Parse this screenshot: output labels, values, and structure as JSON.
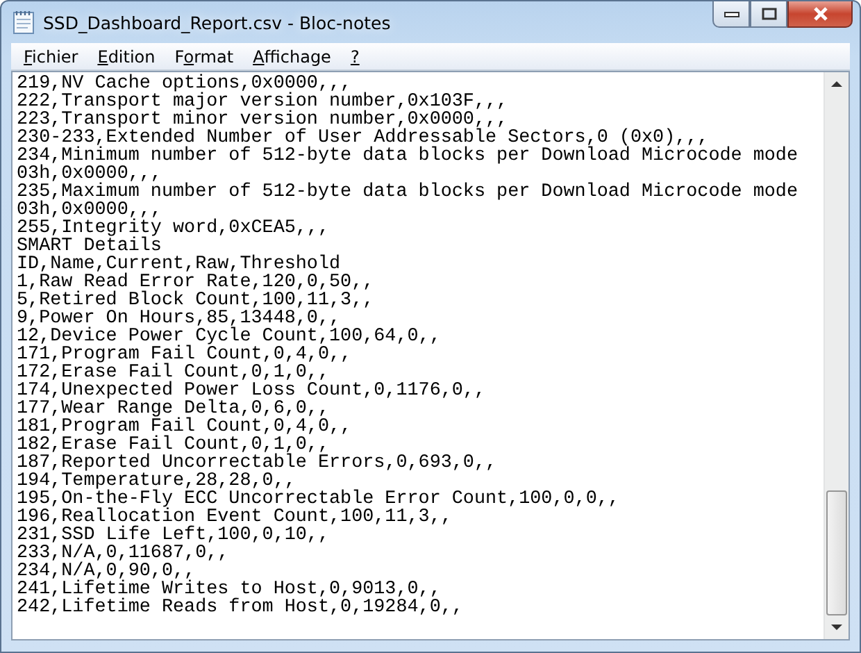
{
  "window": {
    "title": "SSD_Dashboard_Report.csv - Bloc-notes"
  },
  "menu": [
    {
      "key": "F",
      "post": "ichier"
    },
    {
      "key": "E",
      "post": "dition"
    },
    {
      "pre": "F",
      "key": "o",
      "post": "rmat"
    },
    {
      "key": "A",
      "post": "ffichage"
    },
    {
      "key": "?"
    }
  ],
  "lines": [
    "219,NV Cache options,0x0000,,,",
    "222,Transport major version number,0x103F,,,",
    "223,Transport minor version number,0x0000,,,",
    "230-233,Extended Number of User Addressable Sectors,0 (0x0),,,",
    "234,Minimum number of 512-byte data blocks per Download Microcode mode",
    "03h,0x0000,,,",
    "235,Maximum number of 512-byte data blocks per Download Microcode mode",
    "03h,0x0000,,,",
    "255,Integrity word,0xCEA5,,,",
    "SMART Details",
    "ID,Name,Current,Raw,Threshold",
    "1,Raw Read Error Rate,120,0,50,,",
    "5,Retired Block Count,100,11,3,,",
    "9,Power On Hours,85,13448,0,,",
    "12,Device Power Cycle Count,100,64,0,,",
    "171,Program Fail Count,0,4,0,,",
    "172,Erase Fail Count,0,1,0,,",
    "174,Unexpected Power Loss Count,0,1176,0,,",
    "177,Wear Range Delta,0,6,0,,",
    "181,Program Fail Count,0,4,0,,",
    "182,Erase Fail Count,0,1,0,,",
    "187,Reported Uncorrectable Errors,0,693,0,,",
    "194,Temperature,28,28,0,,",
    "195,On-the-Fly ECC Uncorrectable Error Count,100,0,0,,",
    "196,Reallocation Event Count,100,11,3,,",
    "231,SSD Life Left,100,0,10,,",
    "233,N/A,0,11687,0,,",
    "234,N/A,0,90,0,,",
    "241,Lifetime Writes to Host,0,9013,0,,",
    "242,Lifetime Reads from Host,0,19284,0,,"
  ]
}
